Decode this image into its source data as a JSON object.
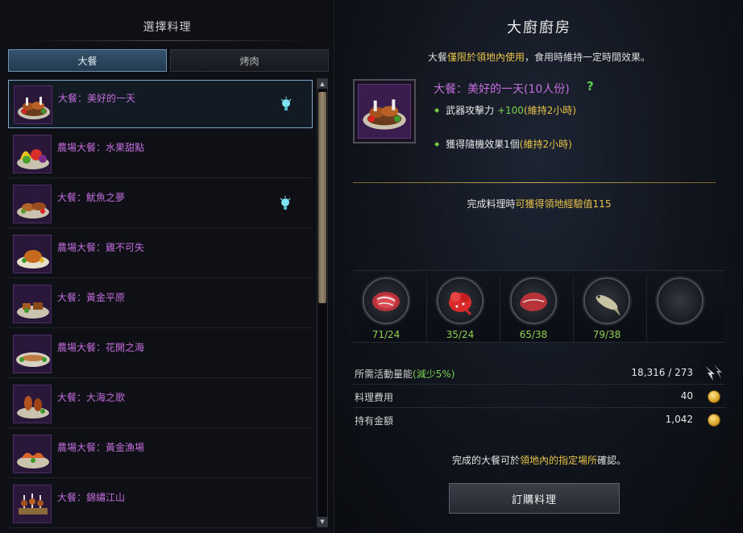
{
  "left": {
    "title": "選擇料理",
    "tabs": [
      {
        "label": "大餐",
        "active": true
      },
      {
        "label": "烤肉",
        "active": false
      }
    ],
    "items": [
      {
        "name": "大餐：美好的一天",
        "selected": true,
        "bulb": true,
        "icon": "roast-meat-platter"
      },
      {
        "name": "農場大餐：水果甜點",
        "selected": false,
        "bulb": false,
        "icon": "fruit-platter"
      },
      {
        "name": "大餐：魷魚之夢",
        "selected": false,
        "bulb": true,
        "icon": "squid-platter"
      },
      {
        "name": "農場大餐：雞不可失",
        "selected": false,
        "bulb": false,
        "icon": "roast-chicken-platter"
      },
      {
        "name": "大餐：黃金平原",
        "selected": false,
        "bulb": false,
        "icon": "golden-plain-platter"
      },
      {
        "name": "農場大餐：花開之海",
        "selected": false,
        "bulb": false,
        "icon": "fish-platter"
      },
      {
        "name": "大餐：大海之歌",
        "selected": false,
        "bulb": false,
        "icon": "seafood-platter"
      },
      {
        "name": "農場大餐：黃金漁場",
        "selected": false,
        "bulb": false,
        "icon": "shrimp-platter"
      },
      {
        "name": "大餐：錦繡江山",
        "selected": false,
        "bulb": false,
        "icon": "skewer-platter"
      }
    ]
  },
  "right": {
    "title": "大廚廚房",
    "subtitle_pre": "大餐",
    "subtitle_highlight": "僅限於領地內使用",
    "subtitle_post": "，食用時維持一定時間效果。",
    "dish_name": "大餐：美好的一天(10人份)",
    "help": "?",
    "effects": [
      {
        "text": "武器攻擊力 ",
        "value": "+100",
        "duration": "(維持2小時)"
      },
      {
        "text": "獲得隨機效果1個",
        "value": "",
        "duration": "(維持2小時)"
      }
    ],
    "exp_pre": "完成料理時",
    "exp_highlight": "可獲得領地經驗值115",
    "ingredients": [
      {
        "icon": "raw-steak-icon",
        "count": "71/24"
      },
      {
        "icon": "red-fish-icon",
        "count": "35/24"
      },
      {
        "icon": "raw-meat-icon",
        "count": "65/38"
      },
      {
        "icon": "silver-fish-icon",
        "count": "79/38"
      },
      {
        "icon": "empty-slot",
        "count": ""
      }
    ],
    "stats": {
      "energy_label": "所需活動量能",
      "energy_discount": "(減少5%)",
      "energy_value": "18,316 / 273",
      "cost_label": "料理費用",
      "cost_value": "40",
      "gold_label": "持有金額",
      "gold_value": "1,042"
    },
    "confirm_pre": "完成的大餐可於",
    "confirm_highlight": "領地內的指定場所",
    "confirm_post": "確認。",
    "order_button": "訂購料理"
  }
}
